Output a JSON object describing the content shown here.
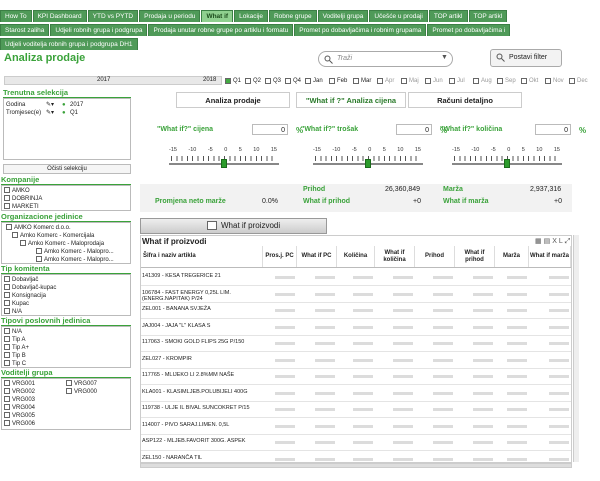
{
  "nav": {
    "row1": [
      "How To",
      "KPI Dashboard",
      "YTD vs PYTD",
      "Prodaja u periodu",
      "What if",
      "Lokacije",
      "Robne grupe",
      "Voditelji grupa",
      "Učešće u prodaji",
      "TOP artikl",
      "TOP artikl"
    ],
    "row2": [
      "Starost zaliha",
      "Udjeli robnih grupa i podgrupa",
      "Prodaja unutar robne grupe po artiklu i formatu",
      "Promet po dobavljačima i robnim grupama",
      "Promet po dobavljačima i"
    ],
    "row3": [
      "Udjeli voditelja robnih grupa i podgrupa DH1"
    ]
  },
  "header": {
    "title": "Analiza prodaje",
    "search_placeholder": "Traži",
    "filter_button": "Postavi filter"
  },
  "years": {
    "y2017": "2017",
    "y2018": "2018"
  },
  "quarters": [
    "Q1",
    "Q2",
    "Q3",
    "Q4"
  ],
  "months": [
    "Jan",
    "Feb",
    "Mar",
    "Apr",
    "Maj",
    "Jun",
    "Jul",
    "Aug",
    "Sep",
    "Okt",
    "Nov",
    "Dec"
  ],
  "current_selection": {
    "title": "Trenutna selekcija",
    "rows": [
      {
        "label": "Godina",
        "value": "2017"
      },
      {
        "label": "Tromjesec(e)",
        "value": "Q1"
      }
    ],
    "clear_button": "Očisti selekciju"
  },
  "sections": {
    "kompanije": {
      "title": "Kompanije",
      "items": [
        "AMKO",
        "DOBRINJA",
        "MARKETI"
      ]
    },
    "org": {
      "title": "Organizacione jedinice",
      "items": [
        "AMKO Komerc d.o.o.",
        "Amko Komerc - Komercijala",
        "Amko Komerc - Maloprodaja",
        "Amko Komerc - Malopro...",
        "Amko Komerc - Malopro..."
      ]
    },
    "tip": {
      "title": "Tip komitenta",
      "items": [
        "Dobavljač",
        "Dobavljač-kupac",
        "Konsignacija",
        "Kupac",
        "N/A"
      ]
    },
    "tipovi": {
      "title": "Tipovi poslovnih jedinica",
      "items": [
        "N/A",
        "Tip A",
        "Tip A+",
        "Tip B",
        "Tip C"
      ]
    },
    "voditelji": {
      "title": "Voditelji grupa",
      "col1": [
        "VRG001",
        "VRG002",
        "VRG003",
        "VRG004",
        "VRG005",
        "VRG006"
      ],
      "col2": [
        "VRG007",
        "VRG000"
      ]
    }
  },
  "main_tabs": {
    "analiza": "Analiza prodaje",
    "whatif": "\"What if ?\" Analiza cijena",
    "racuni": "Računi detaljno"
  },
  "sliders": [
    {
      "label": "\"What if?\" cijena",
      "value": "0",
      "unit": "%"
    },
    {
      "label": "\"What if?\" trošak",
      "value": "0",
      "unit": "%"
    },
    {
      "label": "\"What if?\" količina",
      "value": "0",
      "unit": "%"
    }
  ],
  "scale_ticks": [
    "-15",
    "-10",
    "-5",
    "0",
    "5",
    "10",
    "15"
  ],
  "kpis": {
    "promjena_label": "Promjena neto marže",
    "promjena_value": "0.0%",
    "prihod_label": "Prihod",
    "prihod_value": "26,360,849",
    "wi_prihod_label": "What if prihod",
    "wi_prihod_value": "+0",
    "marza_label": "Marža",
    "marza_value": "2,937,316",
    "wi_marza_label": "What if marža",
    "wi_marza_value": "+0"
  },
  "whatif_button": "What if proizvodi",
  "table": {
    "title": "What if proizvodi",
    "headers": [
      "Šifra i naziv artikla",
      "Pros.j. PC",
      "What if PC",
      "Količina",
      "What if količina",
      "Prihod",
      "What if prihod",
      "Marža",
      "What if marža"
    ],
    "rows": [
      "141309 - KESA TREGERICE 21",
      "106784 - FAST ENERGY 0,25L LIM. (ENERG.NAPITAK) P/24",
      "ZEL001 - BANANA SVJEŽA",
      "JAJ004 - JAJA \"L\" KLASA S",
      "117063 - SMOKI GOLD FLIPS 25G P/150",
      "ZEL027 - KROMPIR",
      "117765 - MLIJEKO LI 2.8%MM NAŠE",
      "KLA001 - KLASIMLJEB.POLUBIJELI 400G",
      "119738 - ULJE IL BIVAL SUNCOKRET P/15",
      "114007 - PIVO SARAJ.LIMEN. 0,5L",
      "ASP122 - MLJEB.FAVORIT 300G. ASPEK",
      "ZEL150 - NARANČA   TIL"
    ]
  }
}
